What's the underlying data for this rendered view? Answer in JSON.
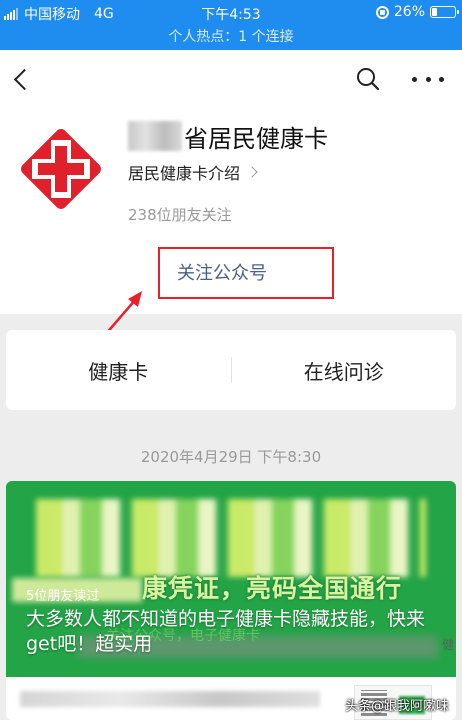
{
  "status_bar": {
    "carrier": "中国移动",
    "network": "4G",
    "time": "下午4:53",
    "battery_text": "26%",
    "battery_level": 0.26
  },
  "hotspot": {
    "text": "个人热点：1 个连接"
  },
  "navbar": {
    "back_icon": "chevron-left-icon",
    "search_icon": "search-icon",
    "more_icon": "more-dots-icon"
  },
  "account": {
    "name_suffix": "省居民健康卡",
    "intro_link": "居民健康卡介绍",
    "followers": "238位朋友关注",
    "follow_button": "关注公众号",
    "logo_color": "#e0202a"
  },
  "tabs": [
    {
      "label": "健康卡"
    },
    {
      "label": "在线问诊"
    }
  ],
  "feed": {
    "timestamp": "2020年4月29日 下午8:30",
    "article": {
      "cover_banner": "康凭证，亮码全国通行",
      "cover_subtext": "关注公众号，电子健康卡",
      "cover_side": "健",
      "read_count": "5位朋友读过",
      "title": "大多数人都不知道的电子健康卡隐藏技能，快来get吧！超实用"
    }
  },
  "watermark": "头条@跟我阿嗽味",
  "colors": {
    "status_bar": "#1f8cf0",
    "annotation_red": "#e8202a",
    "follow_text": "#4a5f8a",
    "cover_green": "#23a447"
  }
}
